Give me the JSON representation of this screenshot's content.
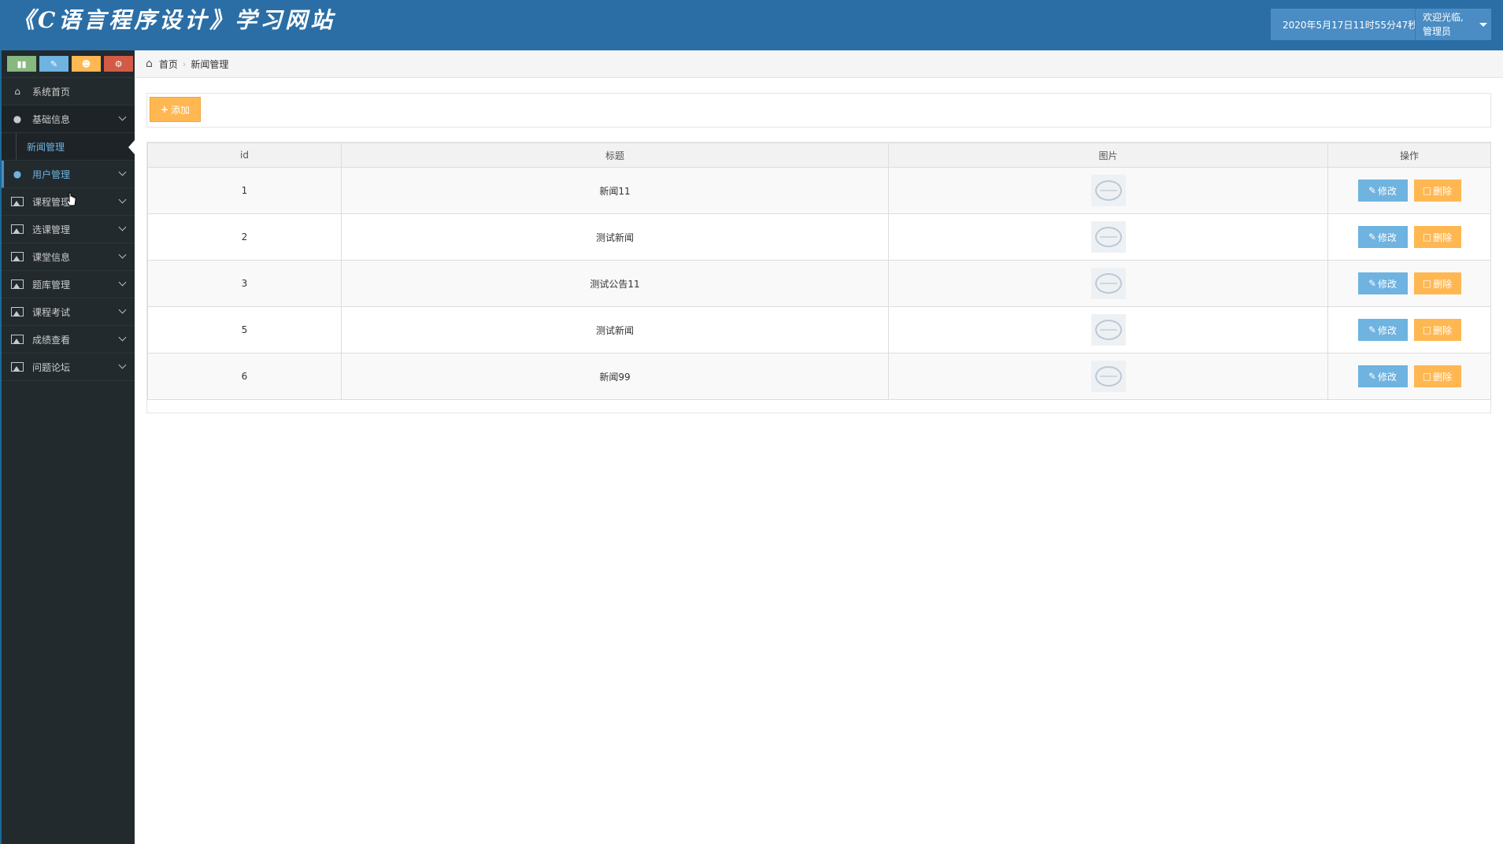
{
  "app": {
    "title": "《C语言程序设计》学习网站"
  },
  "header": {
    "datetime": "2020年5月17日11时55分47秒",
    "welcome": "欢迎光临,管理员"
  },
  "sidebar": {
    "items": [
      {
        "label": "系统首页",
        "icon": "home-icon"
      },
      {
        "label": "基础信息",
        "icon": "user-icon"
      },
      {
        "label": "新闻管理",
        "icon": ""
      },
      {
        "label": "用户管理",
        "icon": "user-icon"
      },
      {
        "label": "课程管理",
        "icon": "picture-icon"
      },
      {
        "label": "选课管理",
        "icon": "picture-icon"
      },
      {
        "label": "课堂信息",
        "icon": "picture-icon"
      },
      {
        "label": "题库管理",
        "icon": "picture-icon"
      },
      {
        "label": "课程考试",
        "icon": "picture-icon"
      },
      {
        "label": "成绩查看",
        "icon": "picture-icon"
      },
      {
        "label": "问题论坛",
        "icon": "picture-icon"
      }
    ]
  },
  "breadcrumb": {
    "home": "首页",
    "current": "新闻管理"
  },
  "toolbar": {
    "add_label": "添加"
  },
  "table": {
    "headers": [
      "id",
      "标题",
      "图片",
      "操作"
    ],
    "rows": [
      {
        "id": "1",
        "title": "新闻11"
      },
      {
        "id": "2",
        "title": "测试新闻"
      },
      {
        "id": "3",
        "title": "测试公告11"
      },
      {
        "id": "5",
        "title": "测试新闻"
      },
      {
        "id": "6",
        "title": "新闻99"
      }
    ],
    "edit_label": "修改",
    "delete_label": "删除"
  },
  "colors": {
    "header_bg": "#2b6ea5",
    "sidebar_bg": "#222a2d",
    "edit_btn": "#6fb3e0",
    "delete_btn": "#ffb752"
  }
}
